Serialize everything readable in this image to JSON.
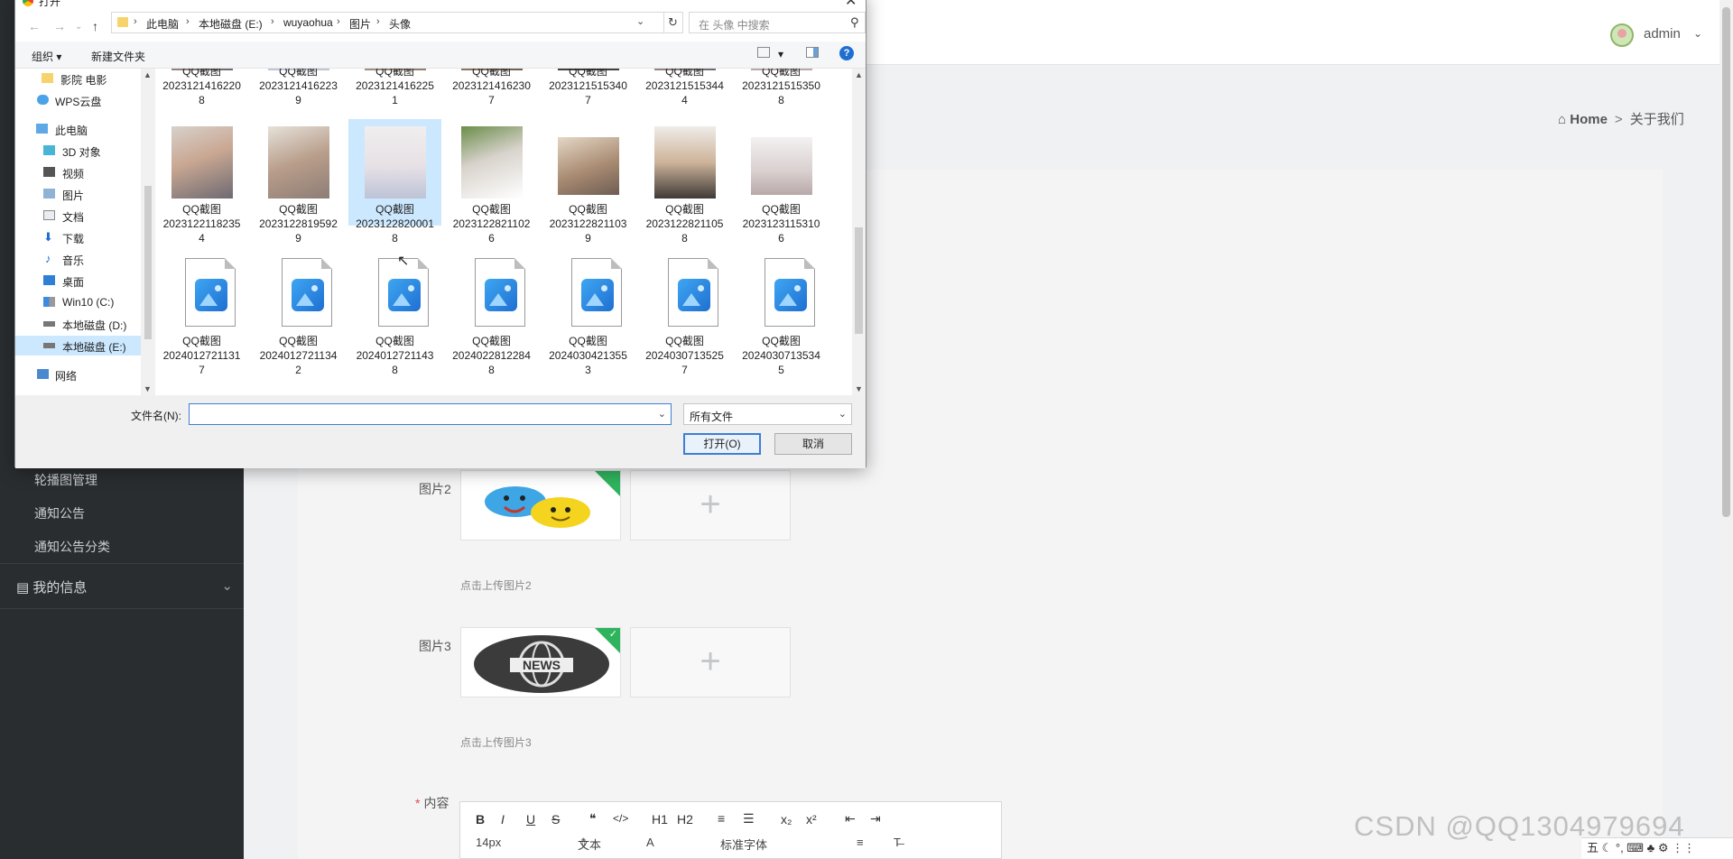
{
  "sidebar": {
    "items": [
      "轮播图管理",
      "通知公告",
      "通知公告分类"
    ],
    "group": "我的信息"
  },
  "header": {
    "username": "admin"
  },
  "breadcrumb": {
    "home": "Home",
    "sep": ">",
    "current": "关于我们"
  },
  "form": {
    "image2_label": "图片2",
    "image2_hint": "点击上传图片2",
    "image3_label": "图片3",
    "image3_hint": "点击上传图片3",
    "content_label": "内容",
    "editor": {
      "font_size": "14px",
      "text_type": "文本",
      "font_family": "标准字体",
      "buttons": [
        "B",
        "I",
        "U",
        "S",
        "❝",
        "</>",
        "H1",
        "H2",
        "≡",
        "☰",
        "x₂",
        "x²",
        "⇤",
        "⇥"
      ]
    }
  },
  "dialog": {
    "title": "打开",
    "path": [
      "此电脑",
      "本地磁盘 (E:)",
      "wuyaohua",
      "图片",
      "头像"
    ],
    "search_placeholder": "在 头像 中搜索",
    "organize": "组织 ▾",
    "new_folder": "新建文件夹",
    "nav": [
      "影院 电影",
      "WPS云盘",
      "此电脑",
      "3D 对象",
      "视频",
      "图片",
      "文档",
      "下载",
      "音乐",
      "桌面",
      "Win10 (C:)",
      "本地磁盘 (D:)",
      "本地磁盘 (E:)",
      "网络"
    ],
    "files_row1": [
      "QQ截图\n2023121416220\n8",
      "QQ截图\n2023121416223\n9",
      "QQ截图\n2023121416225\n1",
      "QQ截图\n2023121416230\n7",
      "QQ截图\n2023121515340\n7",
      "QQ截图\n2023121515344\n4",
      "QQ截图\n2023121515350\n8"
    ],
    "files_row2": [
      "QQ截图\n2023122118235\n4",
      "QQ截图\n2023122819592\n9",
      "QQ截图\n2023122820001\n8",
      "QQ截图\n2023122821102\n6",
      "QQ截图\n2023122821103\n9",
      "QQ截图\n2023122821105\n8",
      "QQ截图\n2023123115310\n6"
    ],
    "files_row3": [
      "QQ截图\n2024012721131\n7",
      "QQ截图\n2024012721134\n2",
      "QQ截图\n2024012721143\n8",
      "QQ截图\n2024022812284\n8",
      "QQ截图\n2024030421355\n3",
      "QQ截图\n2024030713525\n7",
      "QQ截图\n2024030713534\n5"
    ],
    "filename_label": "文件名(N):",
    "filename_value": "",
    "filetype": "所有文件",
    "open_button": "打开(O)",
    "cancel_button": "取消"
  },
  "watermark": "CSDN @QQ1304979694",
  "tray": "五 ☾ °, ⌨ ♣ ⚙ ⋮⋮"
}
